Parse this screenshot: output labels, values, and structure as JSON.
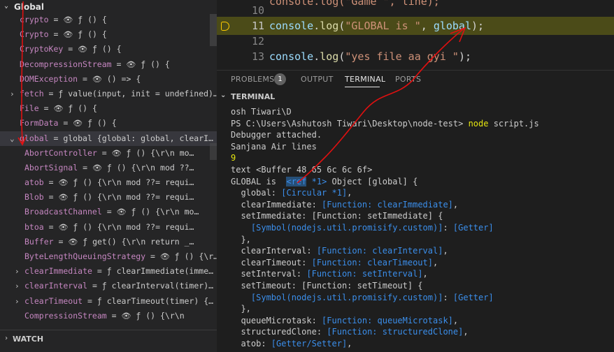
{
  "sidebar": {
    "section_title": "Global",
    "variables": [
      {
        "indent": 28,
        "twisty": "",
        "name": "crypto",
        "eye": true,
        "value": "ƒ () {"
      },
      {
        "indent": 28,
        "twisty": "",
        "name": "Crypto",
        "eye": true,
        "value": "ƒ () {"
      },
      {
        "indent": 28,
        "twisty": "",
        "name": "CryptoKey",
        "eye": true,
        "value": "ƒ () {"
      },
      {
        "indent": 28,
        "twisty": "",
        "name": "DecompressionStream",
        "eye": true,
        "value": "ƒ () {"
      },
      {
        "indent": 28,
        "twisty": "",
        "name": "DOMException",
        "eye": true,
        "value": "() => {"
      },
      {
        "indent": 28,
        "twisty": "›",
        "name": "fetch",
        "eye": false,
        "value": "ƒ value(input, init = undefined)…"
      },
      {
        "indent": 28,
        "twisty": "",
        "name": "File",
        "eye": true,
        "value": "ƒ () {"
      },
      {
        "indent": 28,
        "twisty": "",
        "name": "FormData",
        "eye": true,
        "value": "ƒ () {"
      },
      {
        "indent": 28,
        "twisty": "⌄",
        "name": "global",
        "eye": false,
        "value": "global {global: global, clearI…",
        "selected": true
      },
      {
        "indent": 35,
        "twisty": "",
        "name": "AbortController",
        "eye": true,
        "value": "ƒ () {\\r\\n      mo…"
      },
      {
        "indent": 35,
        "twisty": "",
        "name": "AbortSignal",
        "eye": true,
        "value": "ƒ () {\\r\\n      mod ??…"
      },
      {
        "indent": 35,
        "twisty": "",
        "name": "atob",
        "eye": true,
        "value": "ƒ () {\\r\\n      mod ??= requi…"
      },
      {
        "indent": 35,
        "twisty": "",
        "name": "Blob",
        "eye": true,
        "value": "ƒ () {\\r\\n      mod ??= requi…"
      },
      {
        "indent": 35,
        "twisty": "",
        "name": "BroadcastChannel",
        "eye": true,
        "value": "ƒ () {\\r\\n      mo…"
      },
      {
        "indent": 35,
        "twisty": "",
        "name": "btoa",
        "eye": true,
        "value": "ƒ () {\\r\\n      mod ??= requi…"
      },
      {
        "indent": 35,
        "twisty": "",
        "name": "Buffer",
        "eye": true,
        "value": "ƒ get() {\\r\\n      return _…"
      },
      {
        "indent": 35,
        "twisty": "",
        "name": "ByteLengthQueuingStrategy",
        "eye": true,
        "value": "ƒ () {\\r…"
      },
      {
        "indent": 35,
        "twisty": "›",
        "name": "clearImmediate",
        "eye": false,
        "value": "ƒ clearImmediate(imme…"
      },
      {
        "indent": 35,
        "twisty": "›",
        "name": "clearInterval",
        "eye": false,
        "value": "ƒ clearInterval(timer)…"
      },
      {
        "indent": 35,
        "twisty": "›",
        "name": "clearTimeout",
        "eye": false,
        "value": "ƒ clearTimeout(timer) {…"
      },
      {
        "indent": 35,
        "twisty": "",
        "name": "CompressionStream",
        "eye": true,
        "value": "ƒ () {\\r\\n"
      }
    ],
    "watch_title": "WATCH"
  },
  "editor": {
    "lines": [
      {
        "num": "10",
        "code": [
          {
            "t": "console.log(\"Game \", line);",
            "c": "str"
          }
        ],
        "partial": true
      },
      {
        "num": "11",
        "code": [
          {
            "t": "console",
            "c": "obj"
          },
          {
            "t": ".",
            "c": ""
          },
          {
            "t": "log",
            "c": "fn"
          },
          {
            "t": "(",
            "c": ""
          },
          {
            "t": "\"GLOBAL is \"",
            "c": "str"
          },
          {
            "t": ", ",
            "c": ""
          },
          {
            "t": "global",
            "c": "obj"
          },
          {
            "t": ");",
            "c": ""
          }
        ],
        "active": true
      },
      {
        "num": "12",
        "code": []
      },
      {
        "num": "13",
        "code": [
          {
            "t": "console",
            "c": "obj"
          },
          {
            "t": ".",
            "c": ""
          },
          {
            "t": "log",
            "c": "fn"
          },
          {
            "t": "(",
            "c": ""
          },
          {
            "t": "\"yes file aa gyi \"",
            "c": "str"
          },
          {
            "t": ");",
            "c": ""
          }
        ]
      }
    ]
  },
  "panel": {
    "tabs": [
      "PROBLEMS",
      "OUTPUT",
      "TERMINAL",
      "PORTS"
    ],
    "active_tab": "TERMINAL",
    "problems_count": "1",
    "section_title": "TERMINAL"
  },
  "terminal": {
    "lines": [
      [
        {
          "t": "osh Tiwari\\D",
          "c": ""
        }
      ],
      [
        {
          "t": "PS C:\\Users\\Ashutosh Tiwari\\Desktop\\node-test> ",
          "c": ""
        },
        {
          "t": "node",
          "c": "yl"
        },
        {
          "t": " script.js",
          "c": ""
        }
      ],
      [
        {
          "t": "Debugger attached.",
          "c": ""
        }
      ],
      [
        {
          "t": "Sanjana Air lines",
          "c": ""
        }
      ],
      [
        {
          "t": "9",
          "c": "yl"
        }
      ],
      [
        {
          "t": "text <Buffer 48 65 6c 6c 6f>",
          "c": ""
        }
      ],
      [
        {
          "t": "GLOBAL is  ",
          "c": ""
        },
        {
          "t": "<ref",
          "c": "sel"
        },
        {
          "t": " *1>",
          "c": "cy"
        },
        {
          "t": " Object [global] {",
          "c": ""
        }
      ],
      [
        {
          "t": "  global: ",
          "c": ""
        },
        {
          "t": "[Circular *1]",
          "c": "cy"
        },
        {
          "t": ",",
          "c": ""
        }
      ],
      [
        {
          "t": "  clearImmediate: ",
          "c": ""
        },
        {
          "t": "[Function: clearImmediate]",
          "c": "cy"
        },
        {
          "t": ",",
          "c": ""
        }
      ],
      [
        {
          "t": "  setImmediate: [Function: setImmediate] {",
          "c": ""
        }
      ],
      [
        {
          "t": "    ",
          "c": ""
        },
        {
          "t": "[Symbol(nodejs.util.promisify.custom)]",
          "c": "cy"
        },
        {
          "t": ": ",
          "c": ""
        },
        {
          "t": "[Getter]",
          "c": "cy"
        }
      ],
      [
        {
          "t": "  },",
          "c": ""
        }
      ],
      [
        {
          "t": "  clearInterval: ",
          "c": ""
        },
        {
          "t": "[Function: clearInterval]",
          "c": "cy"
        },
        {
          "t": ",",
          "c": ""
        }
      ],
      [
        {
          "t": "  clearTimeout: ",
          "c": ""
        },
        {
          "t": "[Function: clearTimeout]",
          "c": "cy"
        },
        {
          "t": ",",
          "c": ""
        }
      ],
      [
        {
          "t": "  setInterval: ",
          "c": ""
        },
        {
          "t": "[Function: setInterval]",
          "c": "cy"
        },
        {
          "t": ",",
          "c": ""
        }
      ],
      [
        {
          "t": "  setTimeout: [Function: setTimeout] {",
          "c": ""
        }
      ],
      [
        {
          "t": "    ",
          "c": ""
        },
        {
          "t": "[Symbol(nodejs.util.promisify.custom)]",
          "c": "cy"
        },
        {
          "t": ": ",
          "c": ""
        },
        {
          "t": "[Getter]",
          "c": "cy"
        }
      ],
      [
        {
          "t": "  },",
          "c": ""
        }
      ],
      [
        {
          "t": "  queueMicrotask: ",
          "c": ""
        },
        {
          "t": "[Function: queueMicrotask]",
          "c": "cy"
        },
        {
          "t": ",",
          "c": ""
        }
      ],
      [
        {
          "t": "  structuredClone: ",
          "c": ""
        },
        {
          "t": "[Function: structuredClone]",
          "c": "cy"
        },
        {
          "t": ",",
          "c": ""
        }
      ],
      [
        {
          "t": "  atob: ",
          "c": ""
        },
        {
          "t": "[Getter/Setter]",
          "c": "cy"
        },
        {
          "t": ",",
          "c": ""
        }
      ]
    ]
  },
  "colors": {
    "annotation": "#e01010",
    "breakpoint": "#ffcc00",
    "active_line": "#4b4b18"
  }
}
